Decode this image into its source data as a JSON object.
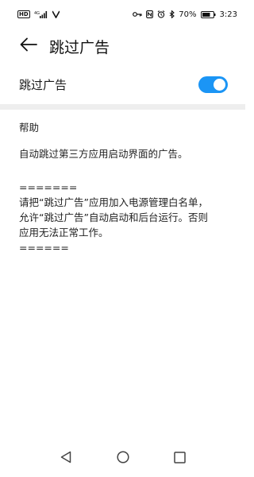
{
  "status_bar": {
    "hd": "HD",
    "network": "4G",
    "battery": "70%",
    "time": "3:23"
  },
  "header": {
    "title": "跳过广告"
  },
  "toggle": {
    "label": "跳过广告",
    "state": "on",
    "color": "#1b95f5"
  },
  "help": {
    "title": "帮助",
    "description": "自动跳过第三方应用启动界面的广告。",
    "note_lines": [
      "=======",
      "请把“跳过广告”应用加入电源管理白名单，",
      "允许“跳过广告”自动启动和后台运行。否则",
      "应用无法正常工作。",
      "======"
    ]
  },
  "icons": {
    "back": "back-arrow-icon",
    "nav_back": "triangle-back-icon",
    "nav_home": "circle-home-icon",
    "nav_recent": "square-recent-icon"
  }
}
